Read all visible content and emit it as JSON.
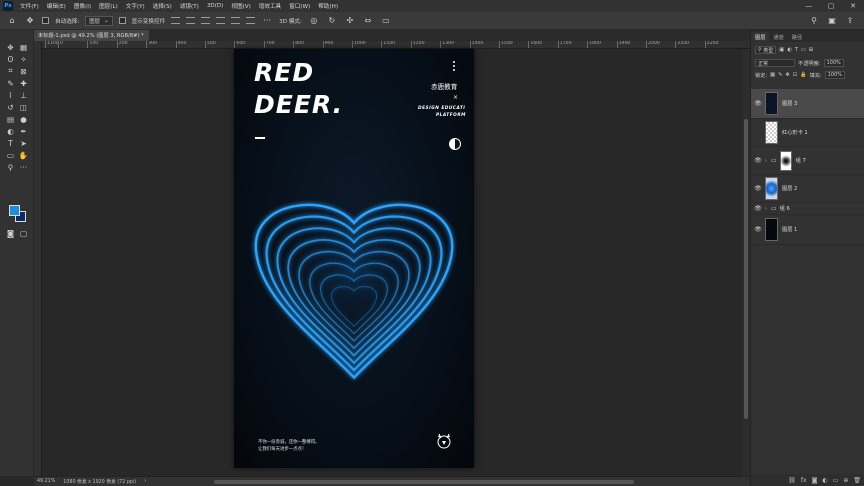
{
  "menu": [
    "文件(F)",
    "编辑(E)",
    "图像(I)",
    "图层(L)",
    "文字(Y)",
    "选择(S)",
    "滤镜(T)",
    "3D(D)",
    "视图(V)",
    "增效工具",
    "窗口(W)",
    "帮助(H)"
  ],
  "window_controls": [
    "—",
    "▢",
    "✕"
  ],
  "options": {
    "auto_select_label": "自动选择:",
    "auto_select_value": "图层",
    "show_transform_label": "显示变换控件",
    "mode_3d_label": "3D 模式:"
  },
  "document_tab": {
    "title": "未标题-1.psd @ 49.2% (图层 3, RGB/8#) *",
    "close": "×"
  },
  "ruler_labels": [
    "0",
    "100",
    "200",
    "300",
    "400",
    "500",
    "600",
    "700",
    "800",
    "900",
    "1000",
    "1100",
    "1200",
    "1300",
    "1400",
    "1500",
    "1600",
    "1700",
    "1800",
    "1900",
    "2000",
    "2100",
    "2200"
  ],
  "ruler_first_label": "1100",
  "artboard": {
    "title_line1": "RED",
    "title_line2": "DEER.",
    "brand_cn": "赤鹿教育",
    "brand_x": "×",
    "brand_en_line1": "DESIGN EDUCATI",
    "brand_en_line2": "PLATFORM",
    "caption_line1": "不你一份赤诚，还你一整搏得。",
    "caption_line2": "让我们每天进步一点点！"
  },
  "panel": {
    "tabs": [
      "图层",
      "通道",
      "路径"
    ],
    "filter_kind": "类型",
    "blend_mode": "正常",
    "opacity_label": "不透明度:",
    "opacity_value": "100%",
    "lock_label": "锁定:",
    "fill_label": "填充:",
    "fill_value": "100%",
    "layers": [
      {
        "name": "图层 3",
        "visible": true,
        "selected": true
      },
      {
        "name": "红心形卡 1",
        "visible": false,
        "selected": false
      },
      {
        "name": "组 7",
        "visible": true,
        "selected": false
      },
      {
        "name": "图层 2",
        "visible": true,
        "selected": false
      },
      {
        "name": "组 6",
        "visible": true,
        "selected": false
      },
      {
        "name": "图层 1",
        "visible": true,
        "selected": false
      }
    ]
  },
  "status": {
    "zoom": "49.21%",
    "doc_info": "1080 像素 x 1920 像素 (72 ppi)"
  },
  "colors": {
    "foreground": "#1a8fe0",
    "background": "#0d2c63",
    "heart_glow": "#2aa5ff"
  }
}
